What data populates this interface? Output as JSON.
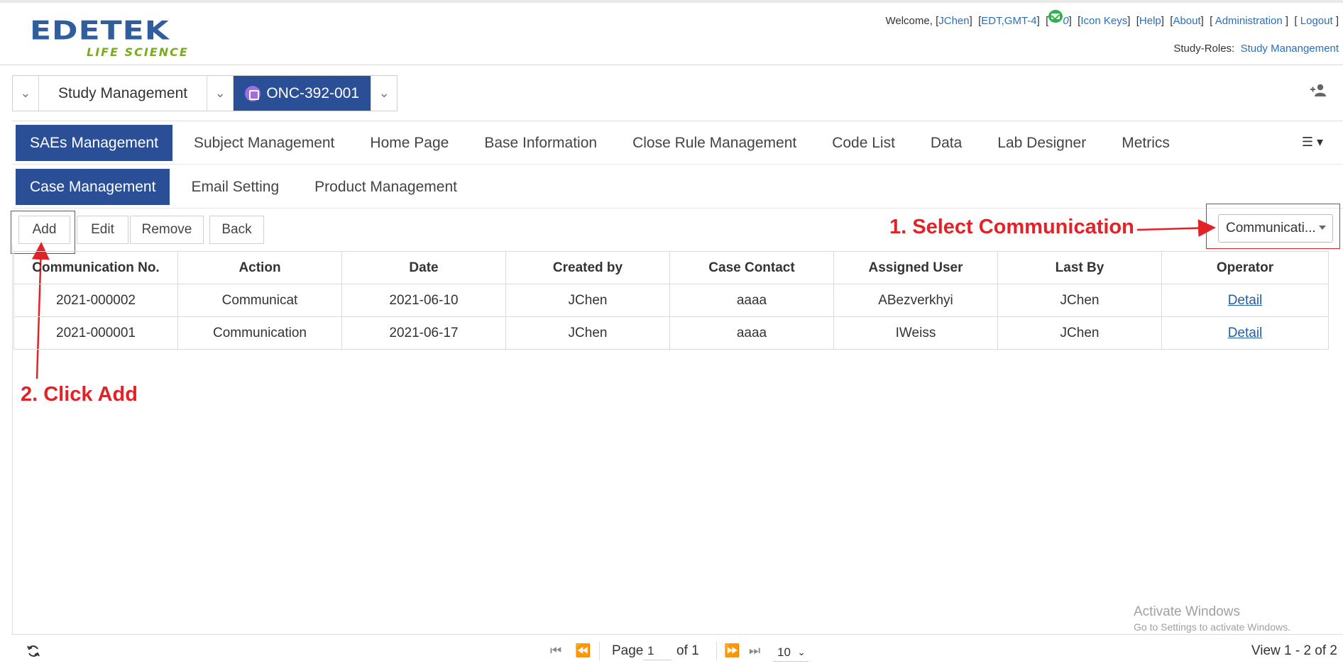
{
  "header": {
    "logo": {
      "brand": "EDETEK",
      "sub": "LIFE SCIENCE"
    },
    "welcome_label": "Welcome,",
    "user": "JChen",
    "timezone": "EDT,GMT-4",
    "mail_count": "0",
    "links": {
      "icon_keys": "Icon Keys",
      "help": "Help",
      "about": "About",
      "administration": "Administration",
      "logout": "Logout"
    },
    "study_roles_label": "Study-Roles:",
    "study_roles_value": "Study Manangement"
  },
  "selector": {
    "module": "Study Management",
    "study": "ONC-392-001"
  },
  "tabs_row1": [
    "SAEs Management",
    "Subject Management",
    "Home Page",
    "Base Information",
    "Close Rule Management",
    "Code List",
    "Data",
    "Lab Designer",
    "Metrics"
  ],
  "tabs_row2": [
    "Case Management",
    "Email Setting",
    "Product Management"
  ],
  "toolbar": {
    "add": "Add",
    "edit": "Edit",
    "remove": "Remove",
    "back": "Back",
    "filter_value": "Communicati..."
  },
  "annotations": {
    "step1": "1. Select Communication",
    "step2": "2. Click Add"
  },
  "table": {
    "columns": [
      "Communication No.",
      "Action",
      "Date",
      "Created by",
      "Case Contact",
      "Assigned User",
      "Last By",
      "Operator"
    ],
    "rows": [
      [
        "2021-000002",
        "Communicat",
        "2021-06-10",
        "JChen",
        "aaaa",
        "ABezverkhyi",
        "JChen",
        "Detail"
      ],
      [
        "2021-000001",
        "Communication",
        "2021-06-17",
        "JChen",
        "aaaa",
        "IWeiss",
        "JChen",
        "Detail"
      ]
    ]
  },
  "pager": {
    "page_label": "Page",
    "page_value": "1",
    "of_label": "of 1",
    "page_size": "10",
    "view_info": "View 1 - 2 of 2"
  },
  "watermark": {
    "line1": "Activate Windows",
    "line2": "Go to Settings to activate Windows."
  },
  "colors": {
    "primary": "#2b4f96",
    "link": "#2a6ebb",
    "annotation": "#e32228"
  }
}
